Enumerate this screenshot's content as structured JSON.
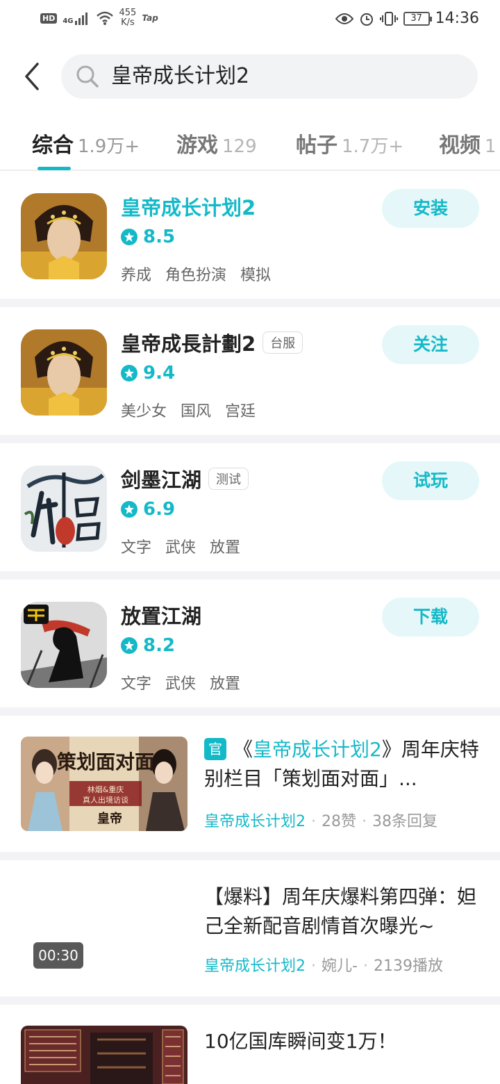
{
  "status_bar": {
    "hd": "HD",
    "network": "4G",
    "speed_value": "455",
    "speed_unit": "K/s",
    "tap": "Tap",
    "battery": "37",
    "time": "14:36"
  },
  "search": {
    "query": "皇帝成长计划2"
  },
  "tabs": [
    {
      "label": "综合",
      "count": "1.9万+"
    },
    {
      "label": "游戏",
      "count": "129"
    },
    {
      "label": "帖子",
      "count": "1.7万+"
    },
    {
      "label": "视频",
      "count": "1"
    }
  ],
  "games": [
    {
      "title": "皇帝成长计划2",
      "badge": "",
      "rating": "8.5",
      "tags": [
        "养成",
        "角色扮演",
        "模拟"
      ],
      "action": "安装"
    },
    {
      "title": "皇帝成長計劃2",
      "badge": "台服",
      "rating": "9.4",
      "tags": [
        "美少女",
        "国风",
        "宫廷"
      ],
      "action": "关注"
    },
    {
      "title": "剑墨江湖",
      "badge": "测试",
      "rating": "6.9",
      "tags": [
        "文字",
        "武侠",
        "放置"
      ],
      "action": "试玩"
    },
    {
      "title": "放置江湖",
      "badge": "",
      "rating": "8.2",
      "tags": [
        "文字",
        "武侠",
        "放置"
      ],
      "action": "下载"
    }
  ],
  "posts": [
    {
      "official_badge": "官",
      "title_prefix": "《",
      "title_game": "皇帝成长计划2",
      "title_suffix": "》周年庆特别栏目「策划面对面」...",
      "meta_game": "皇帝成长计划2",
      "meta_a": "28赞",
      "meta_b": "38条回复",
      "thumb_text": "策划面对面",
      "thumb_sub1": "林烟&重庆",
      "thumb_sub2": "真人出境访谈",
      "thumb_brand": "皇帝"
    },
    {
      "title": "【爆料】周年庆爆料第四弹：妲己全新配音剧情首次曝光~",
      "meta_game": "皇帝成长计划2",
      "meta_a": "婉儿-",
      "meta_b": "2139播放",
      "duration": "00:30"
    },
    {
      "title": "10亿国库瞬间变1万！"
    }
  ],
  "colors": {
    "accent": "#14b9c8",
    "accent_bg": "#e5f7f9",
    "divider": "#f3f3f5"
  },
  "icons": {
    "back": "chevron-left-icon",
    "search": "magnifier-icon",
    "star": "star-icon"
  }
}
